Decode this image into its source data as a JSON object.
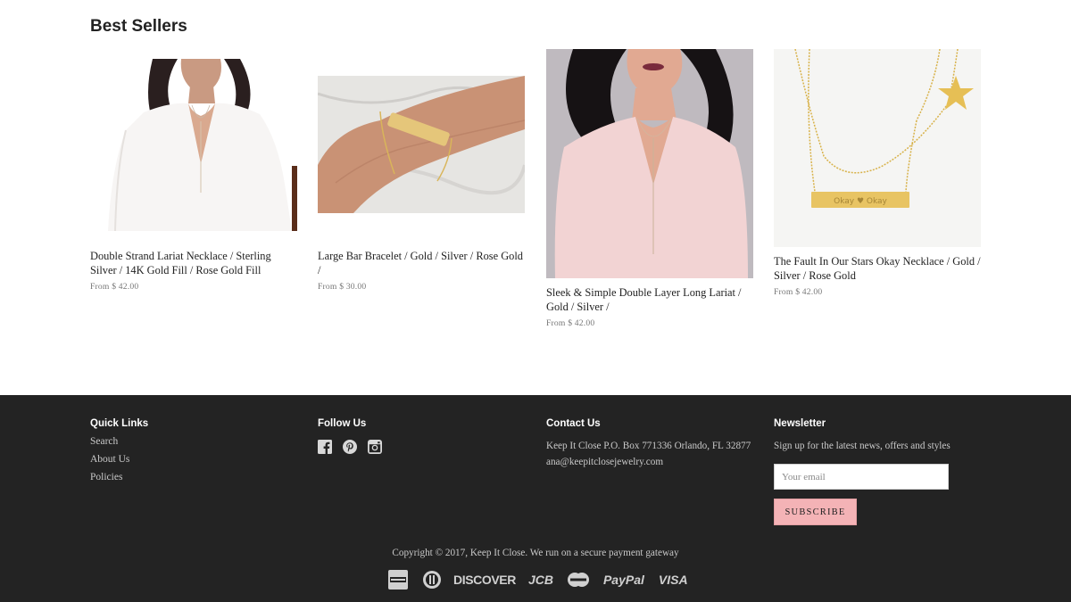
{
  "section": {
    "title": "Best Sellers"
  },
  "products": [
    {
      "title": "Double Strand Lariat Necklace / Sterling Silver / 14K Gold Fill / Rose Gold Fill",
      "price": "From $ 42.00",
      "image": "woman-white-top-lariat"
    },
    {
      "title": "Large Bar Bracelet / Gold / Silver / Rose Gold /",
      "price": "From $ 30.00",
      "image": "wrist-gold-bar-bracelet"
    },
    {
      "title": "Sleek & Simple Double Layer Long Lariat / Gold / Silver /",
      "price": "From $ 42.00",
      "image": "woman-pink-top-lariat"
    },
    {
      "title": "The Fault In Our Stars Okay Necklace / Gold / Silver / Rose Gold",
      "price": "From $ 42.00",
      "image": "star-okay-necklace",
      "engraving": "Okay ♥ Okay"
    }
  ],
  "footer": {
    "quick_links": {
      "heading": "Quick Links",
      "items": [
        "Search",
        "About Us",
        "Policies"
      ]
    },
    "follow_us": {
      "heading": "Follow Us",
      "icons": [
        "facebook-icon",
        "pinterest-icon",
        "instagram-icon"
      ]
    },
    "contact": {
      "heading": "Contact Us",
      "address": "Keep It Close P.O. Box 771336 Orlando, FL 32877",
      "email": "ana@keepitclosejewelry.com"
    },
    "newsletter": {
      "heading": "Newsletter",
      "text": "Sign up for the latest news, offers and styles",
      "placeholder": "Your email",
      "button": "SUBSCRIBE"
    },
    "copyright": "Copyright © 2017, Keep It Close. We run on a secure payment gateway",
    "payments": [
      "american-express",
      "diners-club",
      "DISCOVER",
      "JCB",
      "mastercard",
      "PayPal",
      "VISA"
    ]
  },
  "colors": {
    "footer_bg": "#232323",
    "accent_button": "#f4b3b6"
  }
}
